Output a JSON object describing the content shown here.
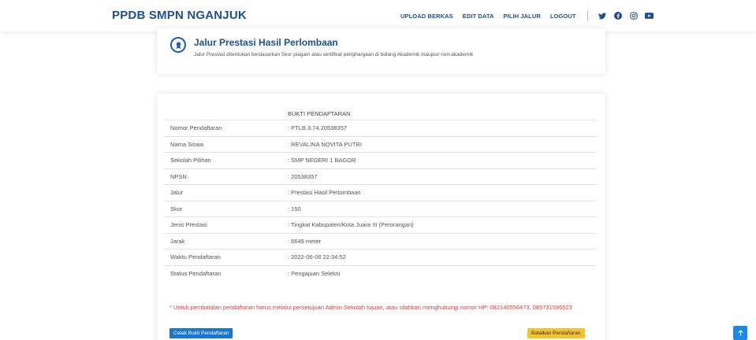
{
  "header": {
    "brand": "PPDB SMPN NGANJUK",
    "nav": {
      "upload": "UPLOAD BERKAS",
      "edit": "EDIT DATA",
      "jalur": "PILIH JALUR",
      "logout": "LOGOUT"
    },
    "social_icons": [
      "twitter-icon",
      "facebook-icon",
      "instagram-icon",
      "youtube-icon"
    ]
  },
  "info_card": {
    "title": "Jalur Prestasi Hasil Perlombaan",
    "description": "Jalur Prestasi ditentukan berdasarkan Skor piagam atau sertifikat penghargaan di bidang Akademik maupun non-akademik"
  },
  "receipt": {
    "title": "BUKTI PENDAFTARAN",
    "rows": [
      {
        "label": "Nomor Pendaftaran",
        "value": ": PTLB.3.74.20538357"
      },
      {
        "label": "Nama Siswa",
        "value": ": REVALINA NOVITA PUTRI"
      },
      {
        "label": "Sekolah Pilihan",
        "value": ": SMP NEGERI 1 BAGOR"
      },
      {
        "label": "NPSN",
        "value": ": 20538357"
      },
      {
        "label": "Jalur",
        "value": ": Prestasi Hasil Perlombaan"
      },
      {
        "label": "Skor",
        "value": ": 150"
      },
      {
        "label": "Jenis Prestasi",
        "value": ": Tingkat Kabupaten/Kota Juara III (Perorangan)"
      },
      {
        "label": "Jarak",
        "value": ": 6649 meter"
      },
      {
        "label": "Waktu Pendaftaran",
        "value": ": 2022-06-06 22:34:52"
      },
      {
        "label": "Status Pendaftaran",
        "value": ": Pengajuan Seleksi"
      }
    ],
    "note": "* Untuk pembatalan pendaftaran harus melalui persetujuan Admin Sekolah tujuan, atau silahkan menghubungi nomor HP: 082140556473, 085731596523",
    "print_button": "Cetak Bukti Pendaftaran",
    "cancel_button": "Batalkan Pendaftaran"
  },
  "colors": {
    "brand": "#1e4f95",
    "primary_button": "#1976d2",
    "warning_button": "#f6c22e",
    "note_text": "#e33b3b"
  }
}
